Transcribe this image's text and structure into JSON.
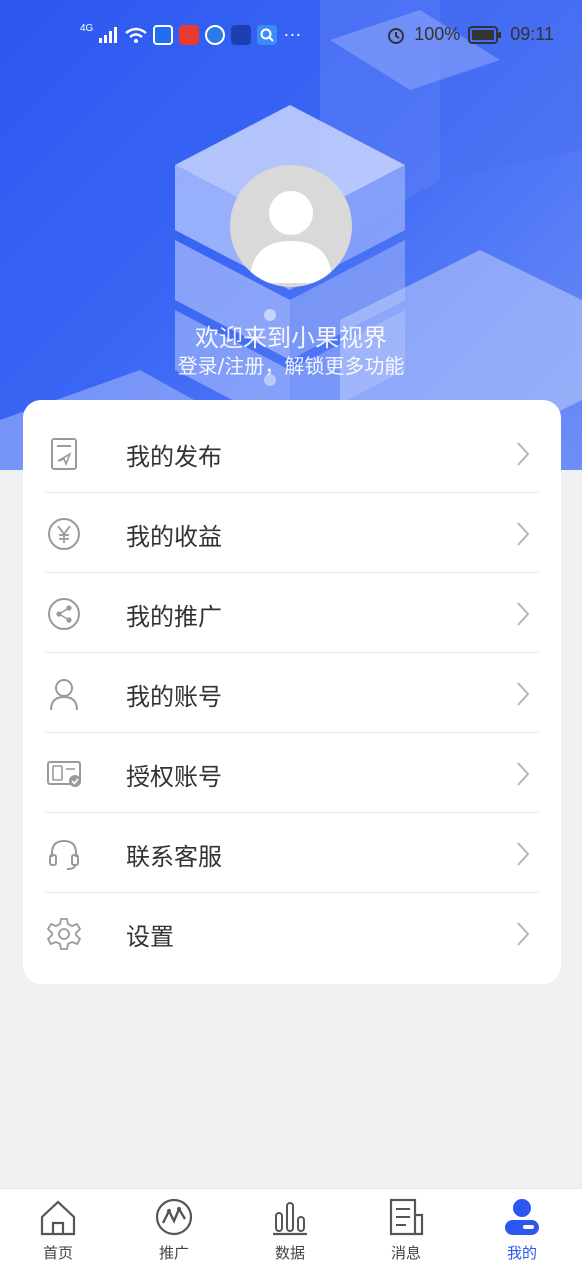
{
  "status_bar": {
    "network": "4G",
    "battery": "100%",
    "time": "09:11",
    "more": "···"
  },
  "profile": {
    "welcome": "欢迎来到小果视界",
    "login_prompt": "登录/注册，解锁更多功能"
  },
  "menu": {
    "items": [
      {
        "label": "我的发布",
        "icon": "publish-icon"
      },
      {
        "label": "我的收益",
        "icon": "yen-icon"
      },
      {
        "label": "我的推广",
        "icon": "share-icon"
      },
      {
        "label": "我的账号",
        "icon": "user-icon"
      },
      {
        "label": "授权账号",
        "icon": "authorized-device-icon"
      },
      {
        "label": "联系客服",
        "icon": "headset-icon"
      },
      {
        "label": "设置",
        "icon": "gear-icon"
      }
    ]
  },
  "tabs": [
    {
      "label": "首页",
      "icon": "home-icon"
    },
    {
      "label": "推广",
      "icon": "promote-icon"
    },
    {
      "label": "数据",
      "icon": "chart-icon"
    },
    {
      "label": "消息",
      "icon": "message-icon"
    },
    {
      "label": "我的",
      "icon": "profile-icon",
      "active": true
    }
  ],
  "colors": {
    "accent": "#2b57f0",
    "text": "#333333",
    "icon_gray": "#9a9a9a",
    "background": "#f0f0f0"
  }
}
